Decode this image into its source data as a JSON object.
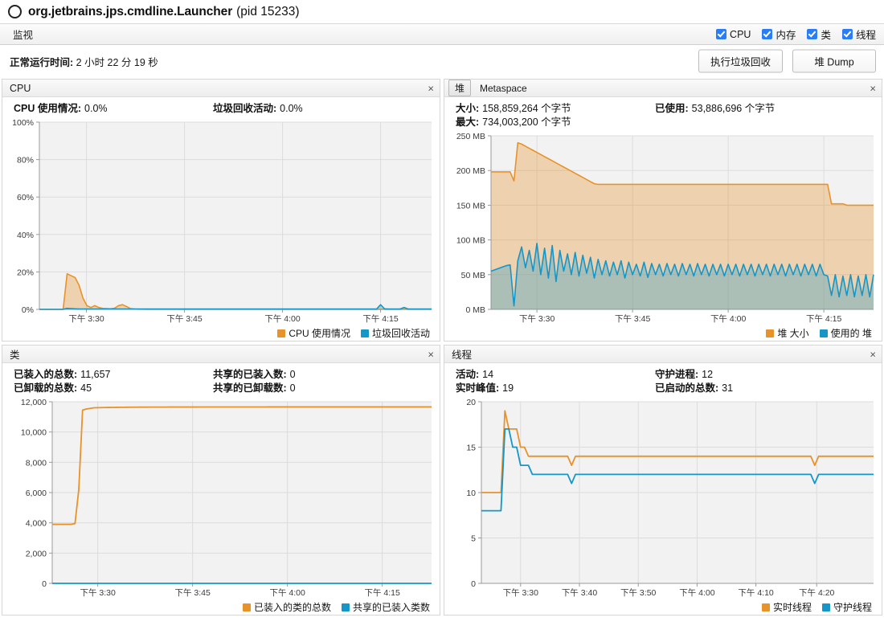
{
  "window": {
    "process_title": "org.jetbrains.jps.cmdline.Launcher",
    "pid_text": "(pid 15233)",
    "process_icon": "circle-icon"
  },
  "tabstrip": {
    "monitor_tab": "监视",
    "checkboxes": [
      {
        "label": "CPU",
        "checked": true
      },
      {
        "label": "内存",
        "checked": true
      },
      {
        "label": "类",
        "checked": true
      },
      {
        "label": "线程",
        "checked": true
      }
    ]
  },
  "info": {
    "uptime_label": "正常运行时间:",
    "uptime_value": "2 小时 22 分 19 秒",
    "gc_button": "执行垃圾回收",
    "heapdump_button": "堆 Dump"
  },
  "panels": {
    "cpu": {
      "title": "CPU",
      "close": "×",
      "stats": [
        {
          "label": "CPU 使用情况:",
          "value": "0.0%",
          "label2": "垃圾回收活动:",
          "value2": "0.0%"
        }
      ]
    },
    "heap": {
      "tab_heap": "堆",
      "tab_metaspace": "Metaspace",
      "close": "×",
      "stats": [
        {
          "label": "大小:",
          "value": "158,859,264 个字节",
          "label2": "已使用:",
          "value2": "53,886,696 个字节"
        },
        {
          "label": "最大:",
          "value": "734,003,200 个字节",
          "label2": "",
          "value2": ""
        }
      ]
    },
    "classes": {
      "title": "类",
      "close": "×",
      "stats": [
        {
          "label": "已装入的总数:",
          "value": "11,657",
          "label2": "共享的已装入数:",
          "value2": "0"
        },
        {
          "label": "已卸载的总数:",
          "value": "45",
          "label2": "共享的已卸载数:",
          "value2": "0"
        }
      ]
    },
    "threads": {
      "title": "线程",
      "close": "×",
      "stats": [
        {
          "label": "活动:",
          "value": "14",
          "label2": "守护进程:",
          "value2": "12"
        },
        {
          "label": "实时峰值:",
          "value": "19",
          "label2": "已启动的总数:",
          "value2": "31"
        }
      ]
    }
  },
  "colors": {
    "orange_line": "#e8922a",
    "orange_fill": "#f8d4a6",
    "blue_line": "#1596c8",
    "blue_fill": "#c9e9f5",
    "grid": "#dcdcdc",
    "axis": "#9a9a9a",
    "plot_bg": "#f2f2f2",
    "checkbox_blue": "#2a7cf7"
  },
  "chart_data": [
    {
      "id": "cpu",
      "type": "area",
      "title": "CPU",
      "ylabel": "",
      "xlabel": "",
      "ylim": [
        0,
        100
      ],
      "yticks": [
        "0%",
        "20%",
        "40%",
        "60%",
        "80%",
        "100%"
      ],
      "ytick_values": [
        0,
        20,
        40,
        60,
        80,
        100
      ],
      "xticks": [
        "下午 3:30",
        "下午 3:45",
        "下午 4:00",
        "下午 4:15"
      ],
      "xtick_positions": [
        0.12,
        0.37,
        0.62,
        0.87
      ],
      "grid": true,
      "legend_position": "bottom-right",
      "series": [
        {
          "name": "CPU 使用情况",
          "color": "#e8922a",
          "values": [
            0,
            0,
            0,
            0,
            0,
            0,
            0,
            19,
            18,
            17,
            13,
            6,
            2,
            1,
            2,
            1,
            0.5,
            0.4,
            0.3,
            0.6,
            2,
            2.5,
            1.5,
            0.4,
            0.2,
            0.1,
            0.1,
            0,
            0,
            0,
            0,
            0,
            0,
            0,
            0,
            0,
            0,
            0,
            0,
            0,
            0,
            0,
            0,
            0,
            0,
            0,
            0,
            0,
            0,
            0,
            0,
            0,
            0,
            0,
            0,
            0,
            0,
            0,
            0,
            0,
            0,
            0,
            0,
            0,
            0,
            0,
            0,
            0,
            0,
            0,
            0,
            0,
            0,
            0,
            0,
            0,
            0,
            0,
            0,
            0,
            0,
            0,
            0,
            0,
            0,
            0,
            0,
            0,
            0,
            0,
            0,
            0,
            0,
            0,
            0,
            0,
            0,
            0,
            0,
            0
          ]
        },
        {
          "name": "垃圾回收活动",
          "color": "#1596c8",
          "values": [
            0,
            0,
            0,
            0,
            0,
            0,
            0,
            0.5,
            0.4,
            0.3,
            0.2,
            0.2,
            0.2,
            0.2,
            0.2,
            0.2,
            0.2,
            0.2,
            0.2,
            0.2,
            0.2,
            0.2,
            0.2,
            0.2,
            0.2,
            0.2,
            0.2,
            0.2,
            0.2,
            0.2,
            0.2,
            0.2,
            0.2,
            0.2,
            0.2,
            0.2,
            0.2,
            0.2,
            0.2,
            0.2,
            0.2,
            0.2,
            0.2,
            0.2,
            0.2,
            0.2,
            0.2,
            0.2,
            0.2,
            0.2,
            0.2,
            0.2,
            0.2,
            0.2,
            0.2,
            0.2,
            0.2,
            0.2,
            0.2,
            0.2,
            0.2,
            0.2,
            0.2,
            0.2,
            0.2,
            0.2,
            0.2,
            0.2,
            0.2,
            0.2,
            0.2,
            0.2,
            0.2,
            0.2,
            0.2,
            0.2,
            0.2,
            0.2,
            0.2,
            0.2,
            0.2,
            0.2,
            0.2,
            0.2,
            0.2,
            0.2,
            0.2,
            2.5,
            0.3,
            0.2,
            0.2,
            0.2,
            0.2,
            1.0,
            0.2,
            0.2,
            0.2,
            0.2,
            0.2,
            0.2,
            0.2
          ]
        }
      ]
    },
    {
      "id": "heap",
      "type": "area",
      "title": "堆",
      "ylabel": "",
      "xlabel": "",
      "ylim": [
        0,
        250
      ],
      "yticks": [
        "0 MB",
        "50 MB",
        "100 MB",
        "150 MB",
        "200 MB",
        "250 MB"
      ],
      "ytick_values": [
        0,
        50,
        100,
        150,
        200,
        250
      ],
      "xticks": [
        "下午 3:30",
        "下午 3:45",
        "下午 4:00",
        "下午 4:15"
      ],
      "xtick_positions": [
        0.12,
        0.37,
        0.62,
        0.87
      ],
      "grid": true,
      "legend_position": "bottom-right",
      "series": [
        {
          "name": "堆 大小",
          "color": "#e8922a",
          "values": [
            198,
            198,
            198,
            198,
            198,
            198,
            185,
            240,
            238,
            235,
            232,
            229,
            226,
            223,
            220,
            217,
            214,
            211,
            208,
            205,
            202,
            199,
            196,
            193,
            190,
            187,
            184,
            181,
            180,
            180,
            180,
            180,
            180,
            180,
            180,
            180,
            180,
            180,
            180,
            180,
            180,
            180,
            180,
            180,
            180,
            180,
            180,
            180,
            180,
            180,
            180,
            180,
            180,
            180,
            180,
            180,
            180,
            180,
            180,
            180,
            180,
            180,
            180,
            180,
            180,
            180,
            180,
            180,
            180,
            180,
            180,
            180,
            180,
            180,
            180,
            180,
            180,
            180,
            180,
            180,
            180,
            180,
            180,
            180,
            180,
            180,
            180,
            180,
            180,
            152,
            152,
            152,
            152,
            150,
            150,
            150,
            150,
            150,
            150,
            150,
            150
          ]
        },
        {
          "name": "使用的 堆",
          "color": "#1596c8",
          "values": [
            55,
            57,
            59,
            61,
            63,
            64,
            5,
            70,
            90,
            60,
            85,
            55,
            95,
            50,
            88,
            45,
            92,
            40,
            85,
            55,
            80,
            50,
            82,
            48,
            78,
            52,
            75,
            45,
            72,
            50,
            70,
            48,
            68,
            50,
            70,
            45,
            68,
            50,
            65,
            48,
            68,
            46,
            66,
            50,
            65,
            48,
            66,
            50,
            65,
            48,
            66,
            50,
            65,
            48,
            66,
            50,
            65,
            48,
            65,
            50,
            65,
            48,
            65,
            50,
            65,
            48,
            65,
            50,
            65,
            48,
            65,
            50,
            65,
            48,
            65,
            50,
            65,
            48,
            65,
            50,
            65,
            48,
            65,
            50,
            65,
            48,
            65,
            50,
            48,
            20,
            50,
            18,
            48,
            20,
            50,
            18,
            48,
            20,
            50,
            18,
            50
          ]
        }
      ]
    },
    {
      "id": "classes",
      "type": "line",
      "title": "类",
      "ylabel": "",
      "xlabel": "",
      "ylim": [
        0,
        12000
      ],
      "yticks": [
        "0",
        "2,000",
        "4,000",
        "6,000",
        "8,000",
        "10,000",
        "12,000"
      ],
      "ytick_values": [
        0,
        2000,
        4000,
        6000,
        8000,
        10000,
        12000
      ],
      "xticks": [
        "下午 3:30",
        "下午 3:45",
        "下午 4:00",
        "下午 4:15"
      ],
      "xtick_positions": [
        0.12,
        0.37,
        0.62,
        0.87
      ],
      "grid": true,
      "legend_position": "bottom-right",
      "series": [
        {
          "name": "已装入的类的总数",
          "color": "#e8922a",
          "values": [
            3900,
            3900,
            3900,
            3900,
            3900,
            3900,
            3950,
            6200,
            11450,
            11520,
            11560,
            11600,
            11610,
            11615,
            11620,
            11625,
            11630,
            11632,
            11634,
            11636,
            11638,
            11640,
            11642,
            11644,
            11645,
            11646,
            11647,
            11648,
            11649,
            11650,
            11650,
            11651,
            11651,
            11652,
            11652,
            11652,
            11653,
            11653,
            11653,
            11654,
            11654,
            11654,
            11654,
            11655,
            11655,
            11655,
            11655,
            11655,
            11656,
            11656,
            11656,
            11656,
            11656,
            11656,
            11656,
            11656,
            11656,
            11657,
            11657,
            11657,
            11657,
            11657,
            11657,
            11657,
            11657,
            11657,
            11657,
            11657,
            11657,
            11657,
            11657,
            11657,
            11657,
            11657,
            11657,
            11657,
            11657,
            11657,
            11657,
            11657,
            11657,
            11657,
            11657,
            11657,
            11657,
            11657,
            11657,
            11657,
            11657,
            11657,
            11657,
            11657,
            11657,
            11657,
            11657,
            11657,
            11657,
            11657,
            11657,
            11657,
            11657
          ]
        },
        {
          "name": "共享的已装入类数",
          "color": "#1596c8",
          "values": [
            0,
            0,
            0,
            0,
            0,
            0,
            0,
            0,
            0,
            0,
            0,
            0,
            0,
            0,
            0,
            0,
            0,
            0,
            0,
            0,
            0,
            0,
            0,
            0,
            0,
            0,
            0,
            0,
            0,
            0,
            0,
            0,
            0,
            0,
            0,
            0,
            0,
            0,
            0,
            0,
            0,
            0,
            0,
            0,
            0,
            0,
            0,
            0,
            0,
            0,
            0,
            0,
            0,
            0,
            0,
            0,
            0,
            0,
            0,
            0,
            0,
            0,
            0,
            0,
            0,
            0,
            0,
            0,
            0,
            0,
            0,
            0,
            0,
            0,
            0,
            0,
            0,
            0,
            0,
            0,
            0,
            0,
            0,
            0,
            0,
            0,
            0,
            0,
            0,
            0,
            0,
            0,
            0,
            0,
            0,
            0,
            0,
            0,
            0,
            0,
            0
          ]
        }
      ]
    },
    {
      "id": "threads",
      "type": "line",
      "title": "线程",
      "ylabel": "",
      "xlabel": "",
      "ylim": [
        0,
        20
      ],
      "yticks": [
        "0",
        "5",
        "10",
        "15",
        "20"
      ],
      "ytick_values": [
        0,
        5,
        10,
        15,
        20
      ],
      "xticks": [
        "下午 3:30",
        "下午 3:40",
        "下午 3:50",
        "下午 4:00",
        "下午 4:10",
        "下午 4:20"
      ],
      "xtick_positions": [
        0.1,
        0.25,
        0.4,
        0.55,
        0.7,
        0.855
      ],
      "grid": true,
      "legend_position": "bottom-right",
      "series": [
        {
          "name": "实时线程",
          "color": "#e8922a",
          "values": [
            10,
            10,
            10,
            10,
            10,
            10,
            19,
            17,
            17,
            17,
            15,
            15,
            14,
            14,
            14,
            14,
            14,
            14,
            14,
            14,
            14,
            14,
            14,
            13,
            14,
            14,
            14,
            14,
            14,
            14,
            14,
            14,
            14,
            14,
            14,
            14,
            14,
            14,
            14,
            14,
            14,
            14,
            14,
            14,
            14,
            14,
            14,
            14,
            14,
            14,
            14,
            14,
            14,
            14,
            14,
            14,
            14,
            14,
            14,
            14,
            14,
            14,
            14,
            14,
            14,
            14,
            14,
            14,
            14,
            14,
            14,
            14,
            14,
            14,
            14,
            14,
            14,
            14,
            14,
            14,
            14,
            14,
            14,
            14,
            14,
            13,
            14,
            14,
            14,
            14,
            14,
            14,
            14,
            14,
            14,
            14,
            14,
            14,
            14,
            14,
            14
          ]
        },
        {
          "name": "守护线程",
          "color": "#1596c8",
          "values": [
            8,
            8,
            8,
            8,
            8,
            8,
            17,
            17,
            15,
            15,
            13,
            13,
            13,
            12,
            12,
            12,
            12,
            12,
            12,
            12,
            12,
            12,
            12,
            11,
            12,
            12,
            12,
            12,
            12,
            12,
            12,
            12,
            12,
            12,
            12,
            12,
            12,
            12,
            12,
            12,
            12,
            12,
            12,
            12,
            12,
            12,
            12,
            12,
            12,
            12,
            12,
            12,
            12,
            12,
            12,
            12,
            12,
            12,
            12,
            12,
            12,
            12,
            12,
            12,
            12,
            12,
            12,
            12,
            12,
            12,
            12,
            12,
            12,
            12,
            12,
            12,
            12,
            12,
            12,
            12,
            12,
            12,
            12,
            12,
            12,
            11,
            12,
            12,
            12,
            12,
            12,
            12,
            12,
            12,
            12,
            12,
            12,
            12,
            12,
            12,
            12
          ]
        }
      ]
    }
  ]
}
